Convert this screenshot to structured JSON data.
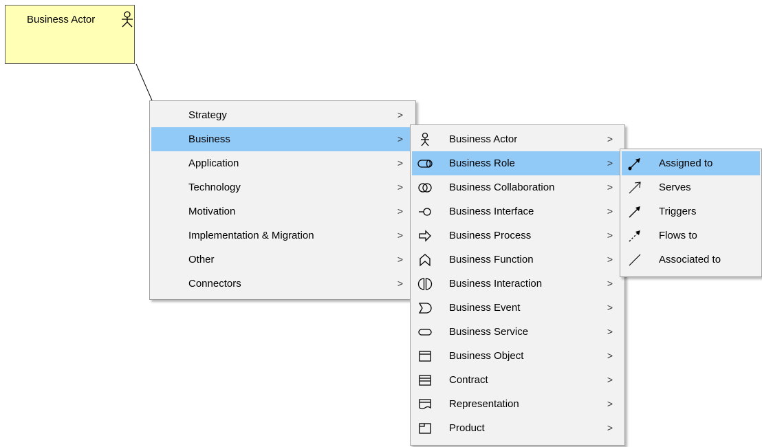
{
  "canvas": {
    "element": {
      "label": "Business Actor",
      "icon": "business-actor-icon",
      "fill_color": "#ffffb5"
    }
  },
  "menu_main": {
    "items": [
      {
        "label": "Strategy",
        "arrow": ">"
      },
      {
        "label": "Business",
        "arrow": ">"
      },
      {
        "label": "Application",
        "arrow": ">"
      },
      {
        "label": "Technology",
        "arrow": ">"
      },
      {
        "label": "Motivation",
        "arrow": ">"
      },
      {
        "label": "Implementation & Migration",
        "arrow": ">"
      },
      {
        "label": "Other",
        "arrow": ">"
      },
      {
        "label": "Connectors",
        "arrow": ">"
      }
    ],
    "highlighted": "Business"
  },
  "menu_business": {
    "items": [
      {
        "label": "Business Actor",
        "icon": "business-actor-icon",
        "arrow": ">"
      },
      {
        "label": "Business Role",
        "icon": "business-role-icon",
        "arrow": ">"
      },
      {
        "label": "Business Collaboration",
        "icon": "business-collaboration-icon",
        "arrow": ">"
      },
      {
        "label": "Business Interface",
        "icon": "business-interface-icon",
        "arrow": ">"
      },
      {
        "label": "Business Process",
        "icon": "business-process-icon",
        "arrow": ">"
      },
      {
        "label": "Business Function",
        "icon": "business-function-icon",
        "arrow": ">"
      },
      {
        "label": "Business Interaction",
        "icon": "business-interaction-icon",
        "arrow": ">"
      },
      {
        "label": "Business Event",
        "icon": "business-event-icon",
        "arrow": ">"
      },
      {
        "label": "Business Service",
        "icon": "business-service-icon",
        "arrow": ">"
      },
      {
        "label": "Business Object",
        "icon": "business-object-icon",
        "arrow": ">"
      },
      {
        "label": "Contract",
        "icon": "contract-icon",
        "arrow": ">"
      },
      {
        "label": "Representation",
        "icon": "representation-icon",
        "arrow": ">"
      },
      {
        "label": "Product",
        "icon": "product-icon",
        "arrow": ">"
      }
    ],
    "highlighted": "Business Role"
  },
  "menu_relations": {
    "items": [
      {
        "label": "Assigned to",
        "icon": "assignment-arrow-icon"
      },
      {
        "label": "Serves",
        "icon": "serving-arrow-icon"
      },
      {
        "label": "Triggers",
        "icon": "triggering-arrow-icon"
      },
      {
        "label": "Flows to",
        "icon": "flow-arrow-icon"
      },
      {
        "label": "Associated to",
        "icon": "association-line-icon"
      }
    ],
    "highlighted": "Assigned to"
  },
  "colors": {
    "menu_background": "#f2f2f2",
    "menu_highlight": "#91c9f7",
    "menu_border": "#a0a0a0",
    "element_fill": "#ffffb5"
  }
}
